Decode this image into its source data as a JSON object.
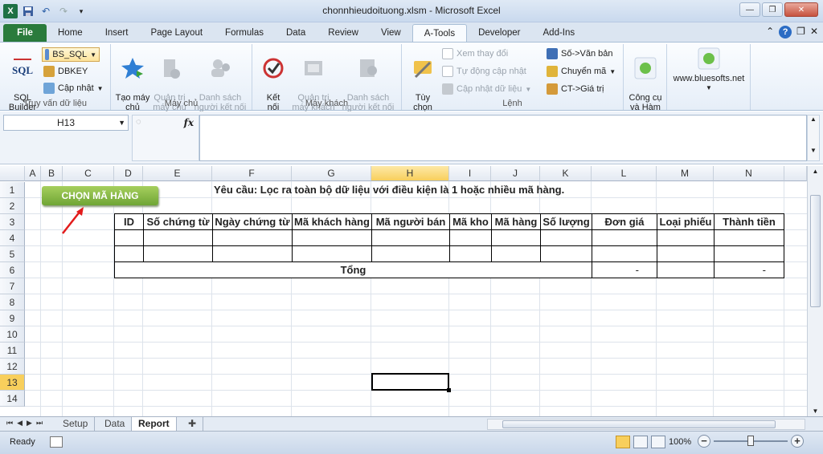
{
  "window": {
    "title": "chonnhieudoituong.xlsm  -  Microsoft Excel"
  },
  "ribbon_tabs": [
    "File",
    "Home",
    "Insert",
    "Page Layout",
    "Formulas",
    "Data",
    "Review",
    "View",
    "A-Tools",
    "Developer",
    "Add-Ins"
  ],
  "active_tab": "A-Tools",
  "ribbon": {
    "group1": {
      "label": "Truy vấn dữ liệu",
      "sql_builder": "SQL\nBuilder",
      "bs_sql": "BS_SQL",
      "dbkey": "DBKEY",
      "cap_nhat": "Cập nhật"
    },
    "group2": {
      "label": "Máy chủ",
      "tao_may_chu": "Tạo máy\nchủ",
      "quan_tri_may_chu": "Quản trị\nmáy chủ",
      "danh_sach_nguoi_ket_noi": "Danh sách\nngười kết nối"
    },
    "group3": {
      "label": "Máy khách",
      "ket_noi": "Kết\nnối",
      "quan_tri_may_khach": "Quản trị\nmáy khách",
      "danh_sach_nguoi_ket_noi": "Danh sách\nngười kết nối"
    },
    "group4": {
      "label": "Lệnh",
      "tuy_chon": "Tùy\nchọn",
      "xem_thay_doi": "Xem thay đổi",
      "tu_dong_cap_nhat": "Tự động cập nhật",
      "cap_nhat_du_lieu": "Cập nhật dữ liệu",
      "so_van_ban": "Số->Văn bản",
      "chuyen_ma": "Chuyển mã",
      "ct_gia_tri": "CT->Giá trị"
    },
    "group5": {
      "cong_cu_va_ham": "Công cụ\nvà Hàm"
    },
    "group6": {
      "website": "www.bluesofts.net"
    }
  },
  "formula_bar": {
    "name_box": "H13",
    "fx": "fx",
    "formula": ""
  },
  "columns": [
    "A",
    "B",
    "C",
    "D",
    "E",
    "F",
    "G",
    "H",
    "I",
    "J",
    "K",
    "L",
    "M",
    "N"
  ],
  "selected_column": "H",
  "rows": [
    "1",
    "2",
    "3",
    "4",
    "5",
    "6",
    "7",
    "8",
    "9",
    "10",
    "11",
    "12",
    "13",
    "14"
  ],
  "selected_row": "13",
  "sheet": {
    "button_label": "CHỌN  MÃ HÀNG",
    "requirement": "Yêu cầu: Lọc ra toàn bộ dữ liệu với điều kiện là 1 hoặc nhiều mã hàng.",
    "table_headers": [
      "ID",
      "Số chứng từ",
      "Ngày chứng từ",
      "Mã khách hàng",
      "Mã người bán",
      "Mã kho",
      "Mã hàng",
      "Số lượng",
      "Đơn giá",
      "Loại phiếu",
      "Thành tiền"
    ],
    "total_label": "Tổng",
    "total_don_gia": "-",
    "total_thanh_tien": "-"
  },
  "sheet_tabs": [
    "Setup",
    "Data",
    "Report"
  ],
  "active_sheet": "Report",
  "status": {
    "ready": "Ready",
    "zoom": "100%"
  }
}
